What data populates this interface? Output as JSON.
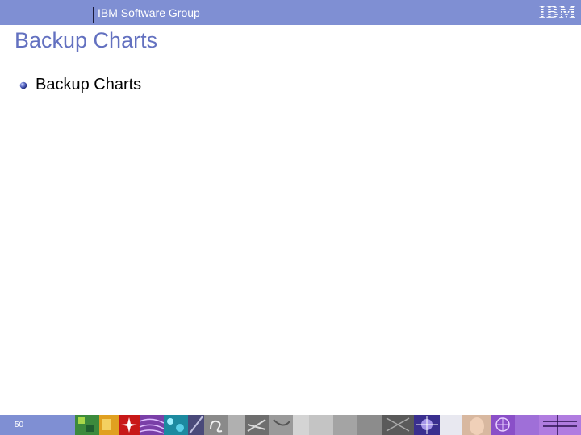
{
  "header": {
    "group_label": "IBM Software Group",
    "logo_text": "IBM",
    "band_color": "#7f8fd3"
  },
  "slide": {
    "title": "Backup Charts",
    "bullets": [
      "Backup Charts"
    ],
    "title_color": "#6371c0"
  },
  "footer": {
    "page_number": "50"
  }
}
